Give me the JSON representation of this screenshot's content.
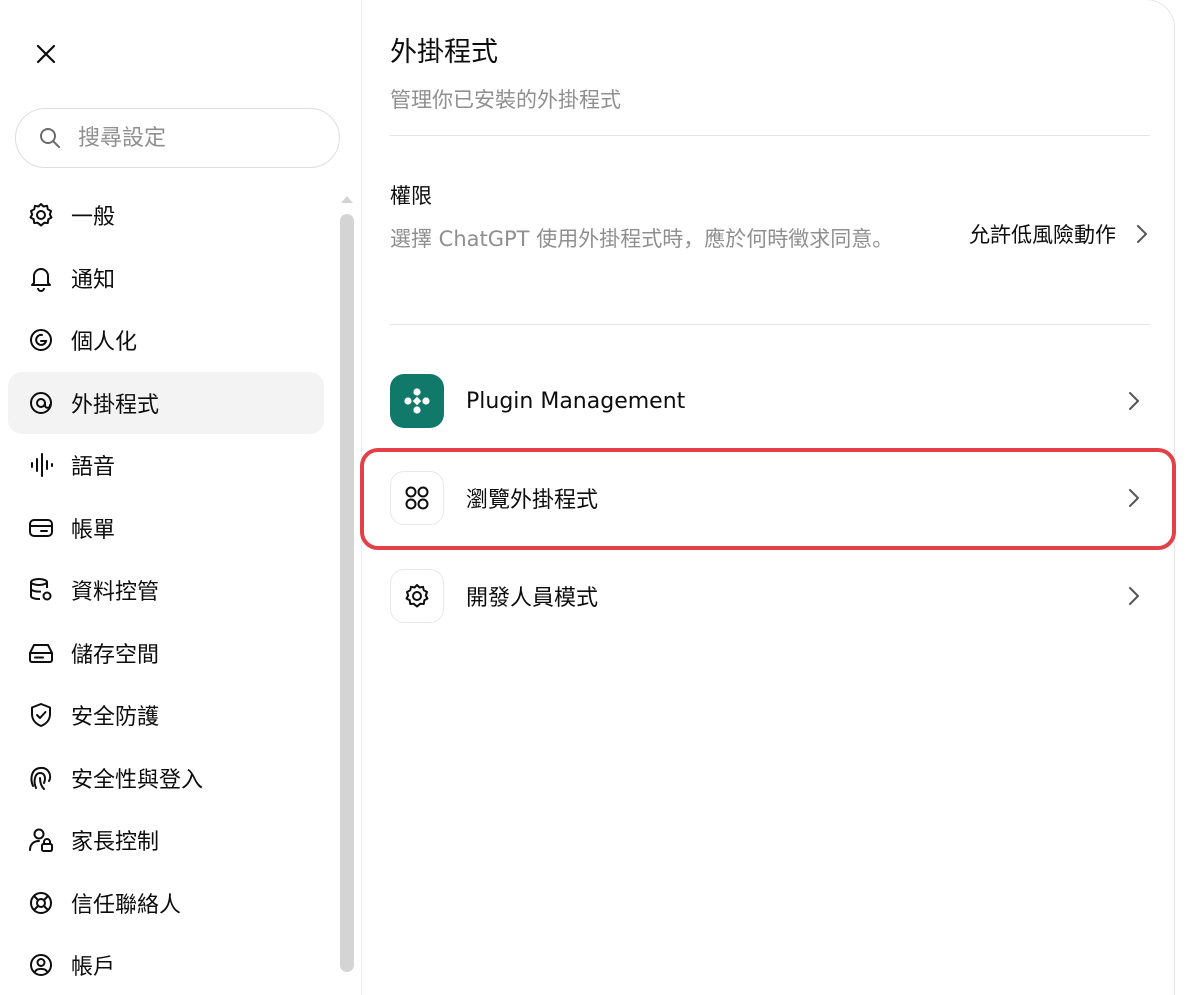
{
  "sidebar": {
    "search_placeholder": "搜尋設定",
    "items": [
      {
        "label": "一般",
        "icon": "gear-icon"
      },
      {
        "label": "通知",
        "icon": "bell-icon"
      },
      {
        "label": "個人化",
        "icon": "personalization-icon"
      },
      {
        "label": "外掛程式",
        "icon": "plugin-icon",
        "active": true
      },
      {
        "label": "語音",
        "icon": "waveform-icon"
      },
      {
        "label": "帳單",
        "icon": "credit-card-icon"
      },
      {
        "label": "資料控管",
        "icon": "database-gear-icon"
      },
      {
        "label": "儲存空間",
        "icon": "storage-icon"
      },
      {
        "label": "安全防護",
        "icon": "shield-check-icon"
      },
      {
        "label": "安全性與登入",
        "icon": "fingerprint-icon"
      },
      {
        "label": "家長控制",
        "icon": "user-lock-icon"
      },
      {
        "label": "信任聯絡人",
        "icon": "lifebuoy-icon"
      },
      {
        "label": "帳戶",
        "icon": "user-circle-icon"
      }
    ]
  },
  "main": {
    "title": "外掛程式",
    "subtitle": "管理你已安裝的外掛程式",
    "permissions": {
      "title": "權限",
      "description": "選擇 ChatGPT 使用外掛程式時，應於何時徵求同意。",
      "value": "允許低風險動作"
    },
    "rows": [
      {
        "label": "Plugin Management",
        "icon": "plugin-management-icon"
      },
      {
        "label": "瀏覽外掛程式",
        "icon": "four-circles-icon"
      },
      {
        "label": "開發人員模式",
        "icon": "gear-icon"
      }
    ]
  },
  "colors": {
    "accent_green": "#10796a",
    "highlight_red": "#e34048",
    "active_bg": "#f3f3f3",
    "muted_text": "#8f8f8f"
  }
}
